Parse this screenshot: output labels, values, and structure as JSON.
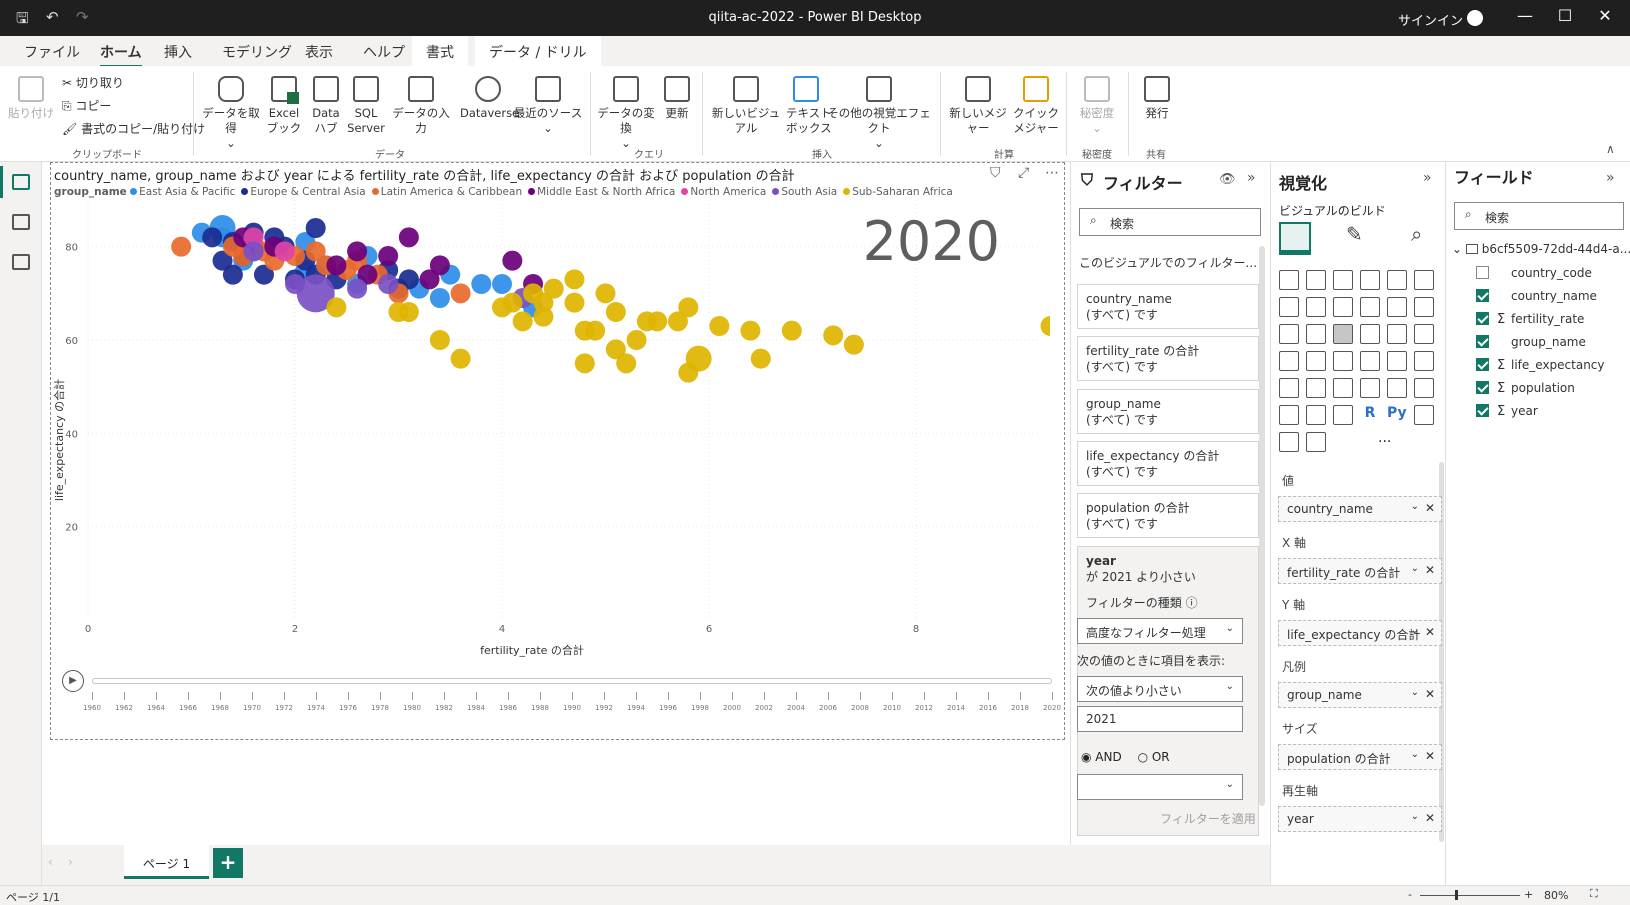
{
  "window": {
    "title": "qiita-ac-2022 - Power BI Desktop",
    "signin": "サインイン"
  },
  "menu": {
    "items": [
      "ファイル",
      "ホーム",
      "挿入",
      "モデリング",
      "表示",
      "ヘルプ",
      "書式",
      "データ / ドリル"
    ],
    "active": "ホーム"
  },
  "ribbon": {
    "paste": "貼り付け",
    "cut": "切り取り",
    "copy": "コピー",
    "format_painter": "書式のコピー/貼り付け",
    "clipboard_group": "クリップボード",
    "get_data": "データを取得",
    "excel": "Excel\nブック",
    "datahub": "Data\nハブ",
    "sql": "SQL\nServer",
    "enter_data": "データの入力",
    "dataverse": "Dataverse",
    "recent": "最近のソース",
    "data_group": "データ",
    "transform": "データの変換",
    "refresh": "更新",
    "query_group": "クエリ",
    "new_visual": "新しいビジュアル",
    "textbox": "テキスト\nボックス",
    "more_visuals": "その他の視覚エフェクト",
    "insert_group": "挿入",
    "new_measure": "新しいメジャー",
    "quick_measure": "クイック\nメジャー",
    "calc_group": "計算",
    "sensitivity": "秘密度",
    "sens_group": "秘密度",
    "publish": "発行",
    "share_group": "共有"
  },
  "visual": {
    "title": "country_name, group_name および year による fertility_rate の合計, life_expectancy の合計 および population の合計",
    "legend_title": "group_name",
    "play_year": "2020"
  },
  "chart_data": {
    "type": "scatter",
    "title": "country_name, group_name および year による fertility_rate の合計, life_expectancy の合計 および population の合計",
    "xlabel": "fertility_rate の合計",
    "ylabel": "life_expectancy の合計",
    "xlim": [
      0,
      8
    ],
    "ylim": [
      0,
      90
    ],
    "x_ticks": [
      "0",
      "2",
      "4",
      "6",
      "8"
    ],
    "y_ticks": [
      "20",
      "40",
      "60",
      "80"
    ],
    "legend_position": "top",
    "series": [
      {
        "name": "East Asia & Pacific",
        "color": "#2e8de8",
        "points": [
          [
            1.3,
            84,
            3
          ],
          [
            1.3,
            82,
            2
          ],
          [
            1.1,
            83,
            2
          ],
          [
            1.6,
            79,
            2
          ],
          [
            1.5,
            77,
            2
          ],
          [
            2.1,
            75,
            2
          ],
          [
            2.6,
            72,
            2
          ],
          [
            3.2,
            71,
            2
          ],
          [
            3.4,
            69,
            2
          ],
          [
            4.3,
            67,
            2
          ],
          [
            2.3,
            76,
            2
          ],
          [
            3.5,
            74,
            2
          ],
          [
            3.8,
            72,
            2
          ],
          [
            2.1,
            81,
            2
          ],
          [
            2.7,
            78,
            2
          ],
          [
            4.0,
            72,
            2
          ],
          [
            1.8,
            80,
            2
          ]
        ]
      },
      {
        "name": "Europe & Central Asia",
        "color": "#1a2b91",
        "points": [
          [
            1.2,
            82,
            2
          ],
          [
            1.4,
            81,
            2
          ],
          [
            1.6,
            80,
            2
          ],
          [
            1.5,
            78,
            2
          ],
          [
            1.8,
            82,
            2
          ],
          [
            1.3,
            77,
            2
          ],
          [
            1.7,
            74,
            2
          ],
          [
            2.0,
            73,
            2
          ],
          [
            1.5,
            79,
            2
          ],
          [
            1.9,
            80,
            2
          ],
          [
            2.1,
            77,
            2
          ],
          [
            1.4,
            74,
            2
          ],
          [
            2.2,
            74,
            2
          ],
          [
            2.9,
            75,
            2
          ],
          [
            3.1,
            73,
            2
          ],
          [
            1.6,
            83,
            2
          ],
          [
            2.4,
            73,
            2
          ],
          [
            3.0,
            71,
            2
          ],
          [
            2.2,
            84,
            2
          ]
        ]
      },
      {
        "name": "Latin America & Caribbean",
        "color": "#e8692c",
        "points": [
          [
            0.9,
            80,
            2
          ],
          [
            1.5,
            78,
            2
          ],
          [
            1.8,
            77,
            2
          ],
          [
            2.0,
            78,
            2
          ],
          [
            2.3,
            76,
            2
          ],
          [
            1.7,
            79,
            2
          ],
          [
            2.5,
            75,
            2
          ],
          [
            2.2,
            79,
            2
          ],
          [
            2.6,
            77,
            2
          ],
          [
            3.0,
            70,
            2
          ],
          [
            3.6,
            70,
            2
          ],
          [
            2.8,
            74,
            2
          ],
          [
            1.4,
            80,
            2
          ]
        ]
      },
      {
        "name": "Middle East & North Africa",
        "color": "#6b007b",
        "points": [
          [
            1.5,
            82,
            2
          ],
          [
            3.1,
            82,
            2
          ],
          [
            2.9,
            78,
            2
          ],
          [
            3.4,
            76,
            2
          ],
          [
            2.4,
            76,
            2
          ],
          [
            2.6,
            79,
            2
          ],
          [
            3.3,
            73,
            2
          ],
          [
            4.3,
            72,
            2
          ],
          [
            4.1,
            77,
            2
          ],
          [
            1.8,
            80,
            2
          ],
          [
            2.7,
            74,
            2
          ]
        ]
      },
      {
        "name": "North America",
        "color": "#e044a7",
        "points": [
          [
            1.6,
            82,
            2
          ],
          [
            1.9,
            79,
            2
          ]
        ]
      },
      {
        "name": "South Asia",
        "color": "#7b4fc4",
        "points": [
          [
            2.2,
            70,
            5
          ],
          [
            2.0,
            72,
            2
          ],
          [
            2.6,
            71,
            2
          ],
          [
            2.9,
            72,
            2
          ],
          [
            4.2,
            69,
            2
          ],
          [
            1.6,
            79,
            2
          ]
        ]
      },
      {
        "name": "Sub-Saharan Africa",
        "color": "#e0b400",
        "points": [
          [
            2.4,
            67,
            2
          ],
          [
            3.0,
            66,
            2
          ],
          [
            4.1,
            68,
            2
          ],
          [
            4.4,
            68,
            2
          ],
          [
            4.7,
            68,
            2
          ],
          [
            5.1,
            66,
            2
          ],
          [
            4.5,
            71,
            2
          ],
          [
            4.0,
            67,
            2
          ],
          [
            4.3,
            70,
            2
          ],
          [
            4.7,
            73,
            2
          ],
          [
            5.0,
            70,
            2
          ],
          [
            5.5,
            64,
            2
          ],
          [
            5.7,
            64,
            2
          ],
          [
            5.1,
            58,
            2
          ],
          [
            6.4,
            62,
            2
          ],
          [
            5.9,
            56,
            3
          ],
          [
            6.8,
            62,
            2
          ],
          [
            7.2,
            61,
            2
          ],
          [
            3.4,
            60,
            2
          ],
          [
            4.2,
            64,
            2
          ],
          [
            5.3,
            60,
            2
          ],
          [
            4.8,
            62,
            2
          ],
          [
            5.8,
            67,
            2
          ],
          [
            6.1,
            63,
            2
          ],
          [
            3.6,
            56,
            2
          ],
          [
            5.2,
            55,
            2
          ],
          [
            5.8,
            53,
            2
          ],
          [
            6.5,
            56,
            2
          ],
          [
            7.4,
            59,
            2
          ],
          [
            9.3,
            63,
            2
          ],
          [
            4.8,
            55,
            2
          ],
          [
            4.4,
            65,
            2
          ],
          [
            4.9,
            62,
            2
          ],
          [
            3.1,
            66,
            2
          ],
          [
            5.4,
            64,
            2
          ]
        ]
      }
    ]
  },
  "timeline": {
    "years": [
      "1960",
      "1962",
      "1964",
      "1966",
      "1968",
      "1970",
      "1972",
      "1974",
      "1976",
      "1978",
      "1980",
      "1982",
      "1984",
      "1986",
      "1988",
      "1990",
      "1992",
      "1994",
      "1996",
      "1998",
      "2000",
      "2002",
      "2004",
      "2006",
      "2008",
      "2010",
      "2012",
      "2014",
      "2016",
      "2018",
      "2020"
    ]
  },
  "pages": {
    "tab": "ページ 1",
    "status": "ページ 1/1",
    "zoom": "80%"
  },
  "filters": {
    "title": "フィルター",
    "search_placeholder": "検索",
    "section": "このビジュアルでのフィルター...",
    "cards": [
      {
        "field": "country_name",
        "value": "(すべて) です"
      },
      {
        "field": "fertility_rate の合計",
        "value": "(すべて) です"
      },
      {
        "field": "group_name",
        "value": "(すべて) です"
      },
      {
        "field": "life_expectancy の合計",
        "value": "(すべて) です"
      },
      {
        "field": "population の合計",
        "value": "(すべて) です"
      }
    ],
    "year_card": {
      "field": "year",
      "condition": "が 2021 より小さい",
      "type_label": "フィルターの種類",
      "type_value": "高度なフィルター処理",
      "show_label": "次の値のときに項目を表示:",
      "operator": "次の値より小さい",
      "value": "2021",
      "and": "AND",
      "or": "OR",
      "apply": "フィルターを適用"
    }
  },
  "viz": {
    "title": "視覚化",
    "build": "ビジュアルのビルド",
    "wells": [
      {
        "label": "値",
        "field": "country_name"
      },
      {
        "label": "X 軸",
        "field": "fertility_rate の合計"
      },
      {
        "label": "Y 軸",
        "field": "life_expectancy の合計"
      },
      {
        "label": "凡例",
        "field": "group_name"
      },
      {
        "label": "サイズ",
        "field": "population の合計"
      },
      {
        "label": "再生軸",
        "field": "year"
      }
    ],
    "more": "···",
    "r": "R",
    "py": "Py"
  },
  "fields": {
    "title": "フィールド",
    "search_placeholder": "検索",
    "table": "b6cf5509-72dd-44d4-a...",
    "items": [
      {
        "name": "country_code",
        "checked": false,
        "sigma": false
      },
      {
        "name": "country_name",
        "checked": true,
        "sigma": false
      },
      {
        "name": "fertility_rate",
        "checked": true,
        "sigma": true
      },
      {
        "name": "group_name",
        "checked": true,
        "sigma": false
      },
      {
        "name": "life_expectancy",
        "checked": true,
        "sigma": true
      },
      {
        "name": "population",
        "checked": true,
        "sigma": true
      },
      {
        "name": "year",
        "checked": true,
        "sigma": true
      }
    ]
  }
}
